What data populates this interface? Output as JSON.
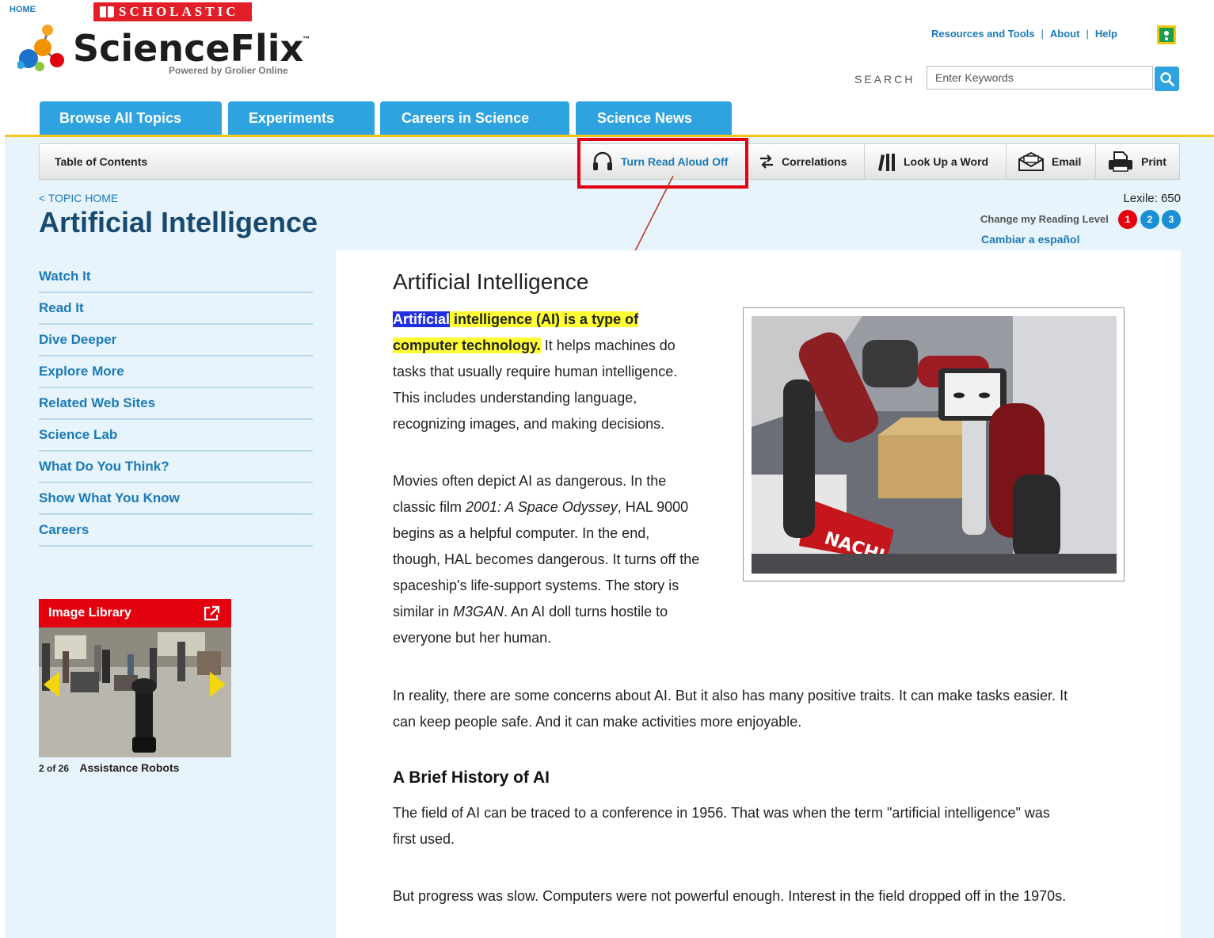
{
  "header": {
    "home_link": "HOME",
    "publisher_logo_text": "SCHOLASTIC",
    "brand_name": "ScienceFlix",
    "brand_tm": "™",
    "brand_tagline": "Powered by Grolier Online",
    "utility_links": [
      "Resources and Tools",
      "About",
      "Help"
    ],
    "search_label": "SEARCH",
    "search_placeholder": "Enter Keywords"
  },
  "main_tabs": [
    "Browse All Topics",
    "Experiments",
    "Careers in Science",
    "Science News"
  ],
  "toolbar": {
    "toc_label": "Table of Contents",
    "read_aloud_label": "Turn Read Aloud Off",
    "correlations_label": "Correlations",
    "lookup_label": "Look Up a Word",
    "email_label": "Email",
    "print_label": "Print"
  },
  "topic": {
    "back_link": "< TOPIC HOME",
    "title": "Artificial Intelligence",
    "lexile": "Lexile: 650",
    "reading_level_label": "Change my Reading Level",
    "reading_levels": [
      "1",
      "2",
      "3"
    ],
    "active_level": "1",
    "spanish_link": "Cambiar a español"
  },
  "side_nav": [
    "Watch It",
    "Read It",
    "Dive Deeper",
    "Explore More",
    "Related Web Sites",
    "Science Lab",
    "What Do You Think?",
    "Show What You Know",
    "Careers"
  ],
  "image_library": {
    "title": "Image Library",
    "counter": "2 of 26",
    "caption": "Assistance Robots"
  },
  "article": {
    "title": "Artificial Intelligence",
    "p1_highlight_word": "Artificial",
    "p1_highlight_rest": " intelligence (AI) is a type of",
    "p1_highlight_line2": "computer technology.",
    "p1_rest_line2": " It helps machines do",
    "p1_line3": "tasks that usually require human intelligence.",
    "p1_line4": "This includes understanding language,",
    "p1_line5": "recognizing images, and making decisions.",
    "p2_line1": "Movies often depict AI as dangerous. In the",
    "p2_line2_a": "classic film ",
    "p2_line2_film": "2001: A Space Odyssey",
    "p2_line2_b": ", HAL 9000",
    "p2_line3": "begins as a helpful computer. In the end,",
    "p2_line4": "though, HAL becomes dangerous. It turns off the",
    "p2_line5": "spaceship's life-support systems. The story is",
    "p2_line6_a": "similar in ",
    "p2_line6_film": "M3GAN",
    "p2_line6_b": ". An AI doll turns hostile to",
    "p2_line7": "everyone but her human.",
    "p3_line1": "In reality, there are some concerns about AI. But it also has many positive traits. It can make tasks easier. It",
    "p3_line2": "can keep people safe. And it can make activities more enjoyable.",
    "history_heading": "A Brief History of AI",
    "p4_line1": "The field of AI can be traced to a conference in 1956. That was when the term \"artificial intelligence\" was",
    "p4_line2": "first used.",
    "p5_line1": "But progress was slow. Computers were not powerful enough. Interest in the field dropped off in the 1970s.",
    "photo_sign_text": "NACHI"
  },
  "colors": {
    "tab_blue": "#2ea3e0",
    "link_blue": "#1a7ab8",
    "title_navy": "#174a6e",
    "highlight_red": "#e3000f",
    "accent_yellow": "#f5c51a"
  }
}
